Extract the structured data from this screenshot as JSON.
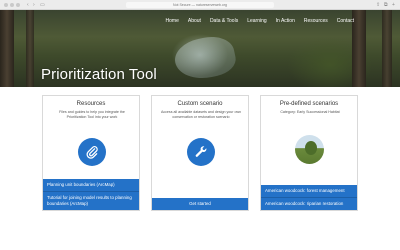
{
  "browser": {
    "url": "Not Secure — natureserveweb.org"
  },
  "nav": {
    "items": [
      "Home",
      "About",
      "Data & Tools",
      "Learning",
      "In Action",
      "Resources",
      "Contact"
    ]
  },
  "hero": {
    "title": "Prioritization Tool"
  },
  "cards": [
    {
      "title": "Resources",
      "description": "Files and guides to help you integrate the Prioritization Tool into your work",
      "icon": "paperclip-icon",
      "buttons": [
        "Planning unit boundaries (ArcMap)",
        "Tutorial for joining model results to planning boundaries (ArcMap)"
      ]
    },
    {
      "title": "Custom scenario",
      "description": "Access all available datasets and design your own conservation or restoration scenario",
      "icon": "wrench-icon",
      "buttons": [
        "Get started"
      ]
    },
    {
      "title": "Pre-defined scenarios",
      "description": "Category: Early Successional Habitat",
      "icon": "habitat-photo",
      "buttons": [
        "American woodcock: forest management",
        "American woodcock: riparian restoration"
      ]
    }
  ],
  "colors": {
    "accent": "#2472c8"
  }
}
